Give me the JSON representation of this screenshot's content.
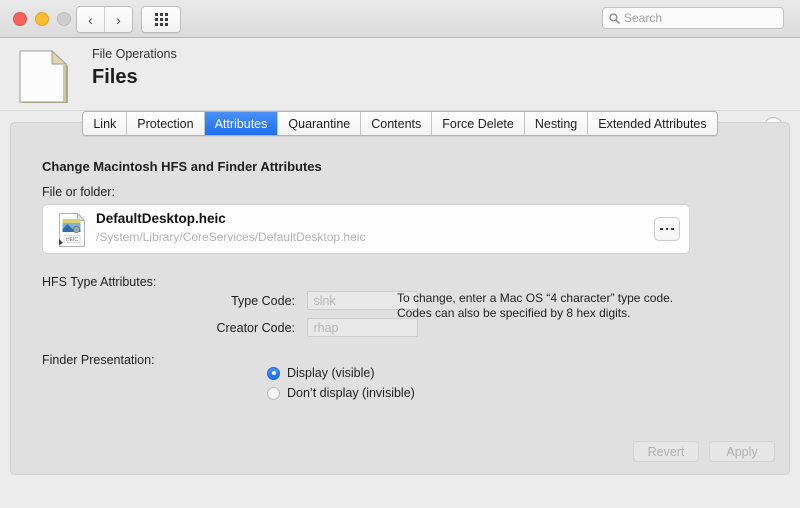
{
  "window": {
    "traffic_lights": [
      "close",
      "minimize",
      "zoom-disabled"
    ],
    "nav_back": "‹",
    "nav_forward": "›",
    "grid_icon": "grid-dots-icon",
    "search": {
      "placeholder": "Search",
      "value": "",
      "icon": "search-icon"
    }
  },
  "header": {
    "subtitle": "File Operations",
    "title": "Files",
    "icon": "document-icon",
    "help_label": "?"
  },
  "tabs": [
    {
      "label": "Link",
      "selected": false
    },
    {
      "label": "Protection",
      "selected": false
    },
    {
      "label": "Attributes",
      "selected": true
    },
    {
      "label": "Quarantine",
      "selected": false
    },
    {
      "label": "Contents",
      "selected": false
    },
    {
      "label": "Force Delete",
      "selected": false
    },
    {
      "label": "Nesting",
      "selected": false
    },
    {
      "label": "Extended Attributes",
      "selected": false
    }
  ],
  "panel": {
    "section_title": "Change Macintosh HFS and Finder Attributes",
    "file_field_label": "File or folder:",
    "file": {
      "name": "DefaultDesktop.heic",
      "path": "/System/Library/CoreServices/DefaultDesktop.heic",
      "icon": "heic-file-icon",
      "icon_badge": "HEIC",
      "browse_label": "browse-ellipsis"
    },
    "hfs": {
      "group_label": "HFS Type Attributes:",
      "type_code_label": "Type Code:",
      "type_code_placeholder": "slnk",
      "type_code_value": "",
      "creator_code_label": "Creator Code:",
      "creator_code_placeholder": "rhap",
      "creator_code_value": "",
      "hint_line1": "To change, enter a Mac OS “4 character” type code.",
      "hint_line2": "Codes can also be specified by 8 hex digits."
    },
    "finder": {
      "group_label": "Finder Presentation:",
      "options": [
        {
          "label": "Display (visible)",
          "selected": true
        },
        {
          "label": "Don’t display (invisible)",
          "selected": false
        }
      ]
    },
    "buttons": {
      "revert": "Revert",
      "apply": "Apply"
    }
  },
  "colors": {
    "accent_blue": "#1d6ef1",
    "window_bg": "#ececec",
    "panel_bg": "#e0e0e0",
    "placeholder_gray": "#b6b6b6"
  }
}
